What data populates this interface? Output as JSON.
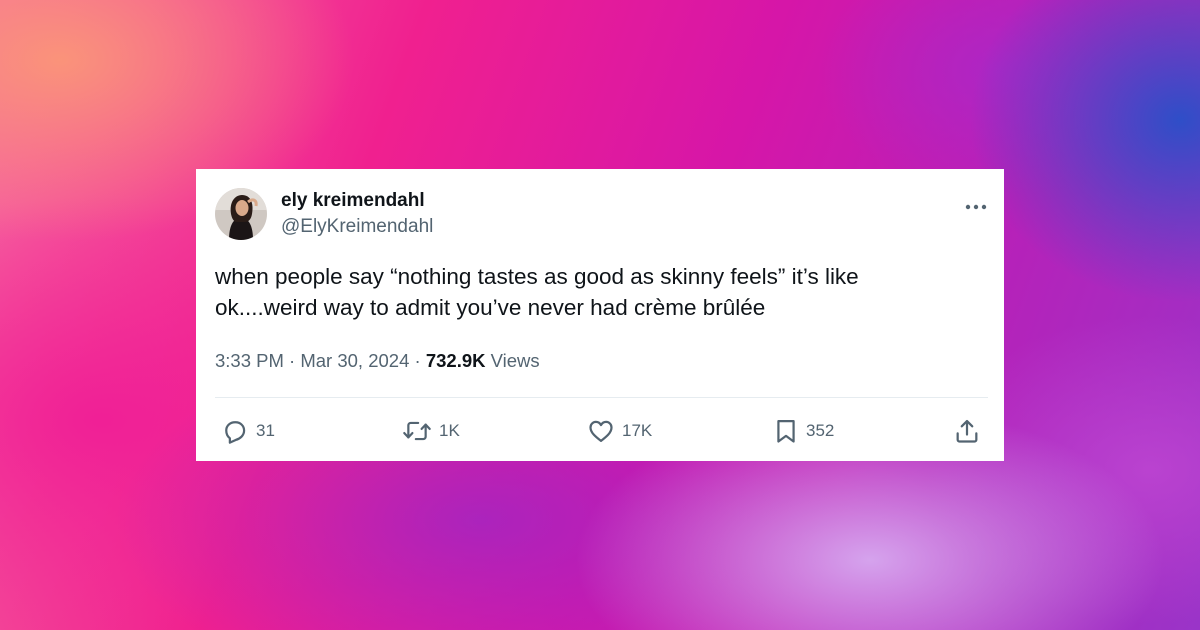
{
  "tweet": {
    "display_name": "ely kreimendahl",
    "handle": "@ElyKreimendahl",
    "text_lines": [
      "when people say “nothing tastes as good as skinny feels” it’s like",
      "ok....weird way to admit you’ve never had crème brûlée"
    ],
    "time": "3:33 PM",
    "separator": "·",
    "date": "Mar 30, 2024",
    "views_count": "732.9K",
    "views_label": "Views"
  },
  "actions": {
    "reply_count": "31",
    "repost_count": "1K",
    "like_count": "17K",
    "bookmark_count": "352"
  },
  "icons": {
    "more": "more-horizontal-icon",
    "reply": "reply-icon",
    "repost": "repost-icon",
    "like": "heart-icon",
    "bookmark": "bookmark-icon",
    "share": "share-icon"
  },
  "colors": {
    "card_bg": "#ffffff",
    "text_primary": "#0f1419",
    "text_secondary": "#536471",
    "divider": "#e6ecf0",
    "background_pink": "#f0208f",
    "background_purple": "#9a34c8"
  }
}
